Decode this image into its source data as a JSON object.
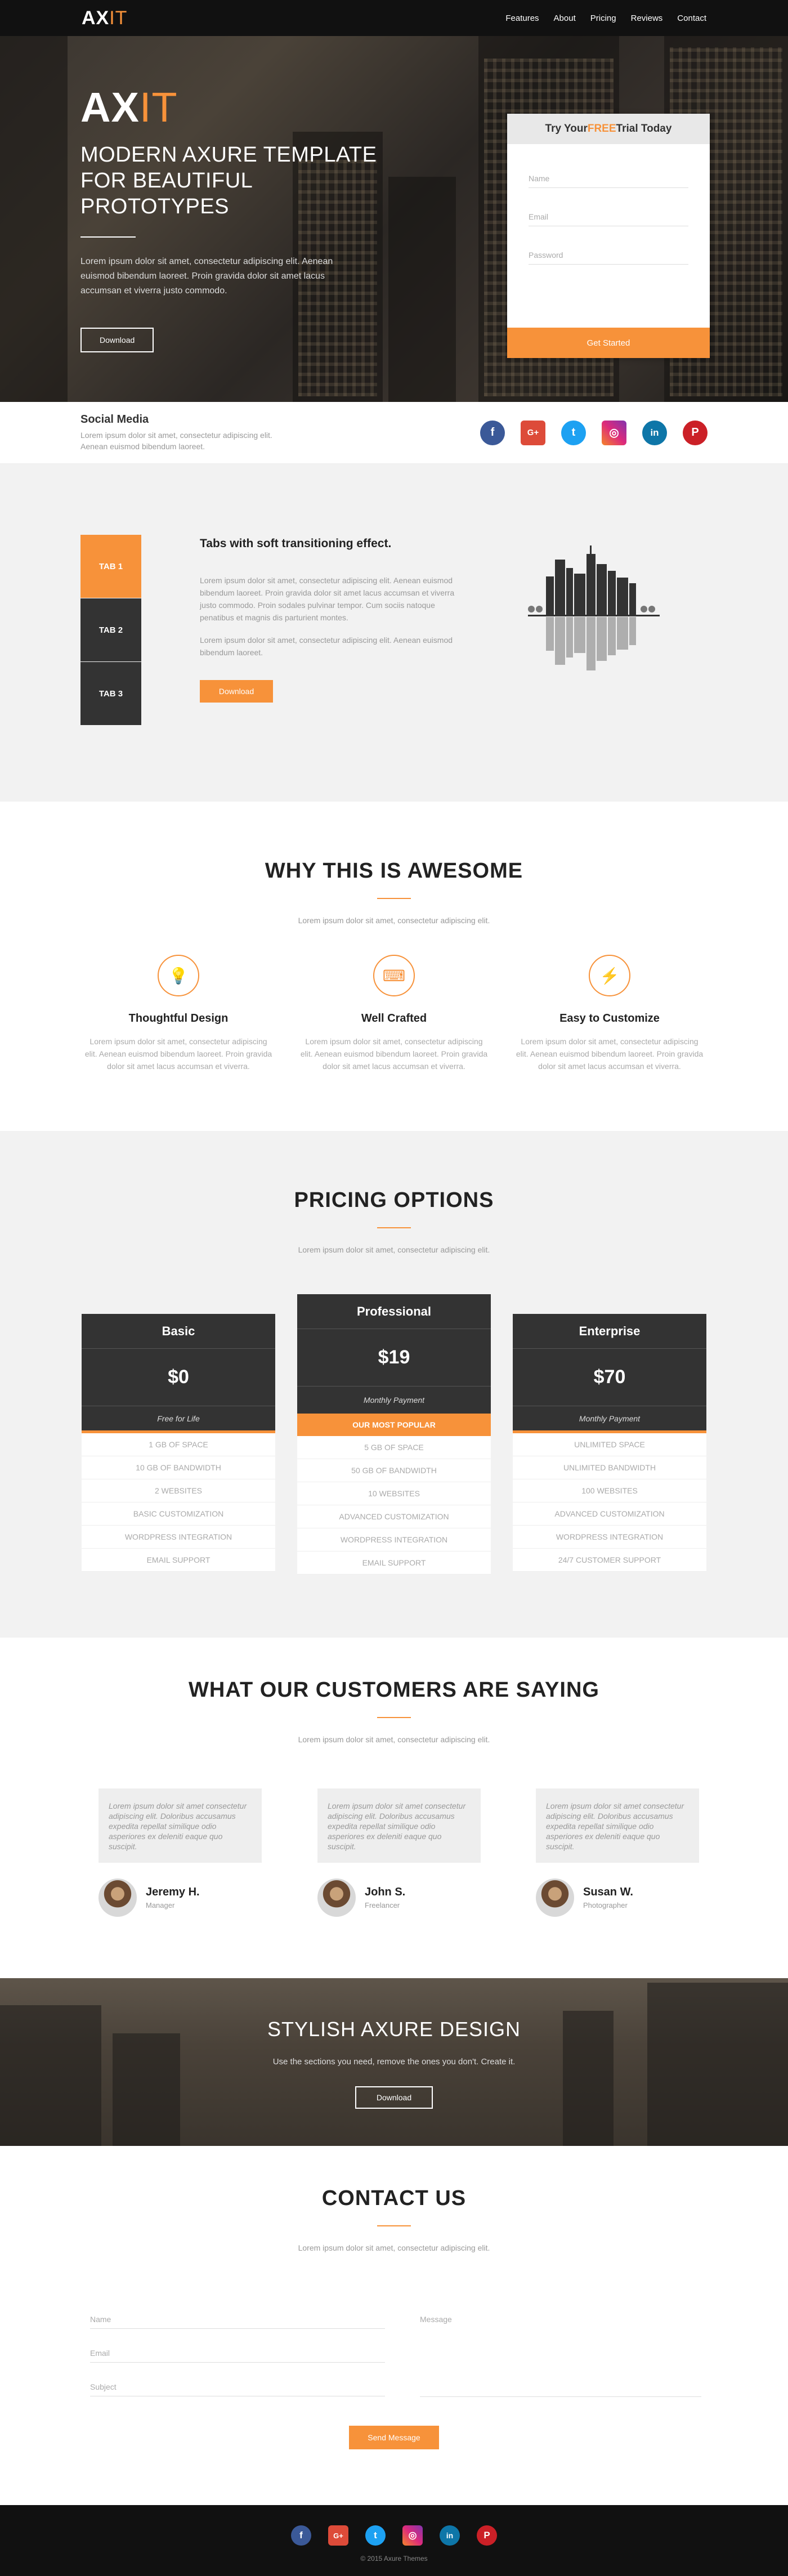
{
  "nav": {
    "logo_main": "AX",
    "logo_accent": "IT",
    "links": [
      "Features",
      "About",
      "Pricing",
      "Reviews",
      "Contact"
    ]
  },
  "hero": {
    "logo_main": "AX",
    "logo_accent": "IT",
    "subtitle_line1": "MODERN AXURE TEMPLATE",
    "subtitle_line2": "FOR BEAUTIFUL PROTOTYPES",
    "text": "Lorem ipsum dolor sit amet, consectetur adipiscing elit. Aenean euismod bibendum laoreet. Proin gravida dolor sit amet lacus accumsan et viverra justo commodo.",
    "button": "Download"
  },
  "trial": {
    "title_prefix": "Try Your ",
    "title_accent": "FREE",
    "title_suffix": " Trial Today",
    "name_placeholder": "Name",
    "email_placeholder": "Email",
    "password_placeholder": "Password",
    "button": "Get Started"
  },
  "social": {
    "title": "Social Media",
    "text": "Lorem ipsum dolor sit amet, consectetur adipiscing elit. Aenean euismod bibendum laoreet.",
    "icons": [
      "f",
      "G+",
      "t",
      "◎",
      "in",
      "P"
    ]
  },
  "tabs": {
    "items": [
      "TAB 1",
      "TAB 2",
      "TAB 3"
    ],
    "title": "Tabs with soft transitioning effect.",
    "para1": "Lorem ipsum dolor sit amet, consectetur adipiscing elit. Aenean euismod bibendum laoreet. Proin gravida dolor sit amet lacus accumsan et viverra justo commodo. Proin sodales pulvinar tempor. Cum sociis natoque penatibus et magnis dis parturient montes.",
    "para2": "Lorem ipsum dolor sit amet, consectetur adipiscing elit. Aenean euismod bibendum laoreet.",
    "button": "Download"
  },
  "awesome": {
    "title": "WHY THIS IS AWESOME",
    "subtitle": "Lorem ipsum dolor sit amet, consectetur adipiscing elit.",
    "features": [
      {
        "icon": "lightbulb-icon",
        "glyph": "💡",
        "title": "Thoughtful Design",
        "text": "Lorem ipsum dolor sit amet, consectetur adipiscing elit. Aenean euismod bibendum laoreet. Proin gravida dolor sit amet lacus accumsan et viverra."
      },
      {
        "icon": "keyboard-icon",
        "glyph": "⌨",
        "title": "Well Crafted",
        "text": "Lorem ipsum dolor sit amet, consectetur adipiscing elit. Aenean euismod bibendum laoreet. Proin gravida dolor sit amet lacus accumsan et viverra."
      },
      {
        "icon": "bolt-icon",
        "glyph": "⚡",
        "title": "Easy to Customize",
        "text": "Lorem ipsum dolor sit amet, consectetur adipiscing elit. Aenean euismod bibendum laoreet. Proin gravida dolor sit amet lacus accumsan et viverra."
      }
    ]
  },
  "pricing": {
    "title": "PRICING OPTIONS",
    "subtitle": "Lorem ipsum dolor sit amet, consectetur adipiscing elit.",
    "plans": [
      {
        "name": "Basic",
        "price": "$0",
        "term": "Free for Life",
        "features": [
          "1 GB OF SPACE",
          "10 GB OF BANDWIDTH",
          "2 WEBSITES",
          "BASIC CUSTOMIZATION",
          "WORDPRESS INTEGRATION",
          "EMAIL SUPPORT"
        ]
      },
      {
        "name": "Professional",
        "price": "$19",
        "term": "Monthly Payment",
        "badge": "OUR MOST POPULAR",
        "features": [
          "5 GB OF SPACE",
          "50 GB OF BANDWIDTH",
          "10 WEBSITES",
          "ADVANCED CUSTOMIZATION",
          "WORDPRESS INTEGRATION",
          "EMAIL SUPPORT"
        ]
      },
      {
        "name": "Enterprise",
        "price": "$70",
        "term": "Monthly Payment",
        "features": [
          "UNLIMITED SPACE",
          "UNLIMITED BANDWIDTH",
          "100 WEBSITES",
          "ADVANCED CUSTOMIZATION",
          "WORDPRESS INTEGRATION",
          "24/7 CUSTOMER SUPPORT"
        ]
      }
    ]
  },
  "reviews": {
    "title": "WHAT OUR CUSTOMERS ARE SAYING",
    "subtitle": "Lorem ipsum dolor sit amet, consectetur adipiscing elit.",
    "items": [
      {
        "quote": "Lorem ipsum dolor sit amet consectetur adipiscing elit. Doloribus accusamus expedita repellat similique odio asperiores ex deleniti eaque quo suscipit.",
        "name": "Jeremy H.",
        "role": "Manager"
      },
      {
        "quote": "Lorem ipsum dolor sit amet consectetur adipiscing elit. Doloribus accusamus expedita repellat similique odio asperiores ex deleniti eaque quo suscipit.",
        "name": "John S.",
        "role": "Freelancer"
      },
      {
        "quote": "Lorem ipsum dolor sit amet consectetur adipiscing elit. Doloribus accusamus expedita repellat similique odio asperiores ex deleniti eaque quo suscipit.",
        "name": "Susan W.",
        "role": "Photographer"
      }
    ]
  },
  "stylish": {
    "title": "STYLISH AXURE DESIGN",
    "text": "Use the sections you need, remove the ones you don't. Create it.",
    "button": "Download"
  },
  "contact": {
    "title": "CONTACT US",
    "subtitle": "Lorem ipsum dolor sit amet, consectetur adipiscing elit.",
    "name_placeholder": "Name",
    "email_placeholder": "Email",
    "subject_placeholder": "Subject",
    "message_placeholder": "Message",
    "button": "Send Message"
  },
  "footer": {
    "icons": [
      "f",
      "G+",
      "t",
      "◎",
      "in",
      "P"
    ],
    "copyright": "© 2015 Axure Themes"
  },
  "colors": {
    "accent": "#f7923a",
    "dark": "#111111",
    "card": "#333333"
  }
}
